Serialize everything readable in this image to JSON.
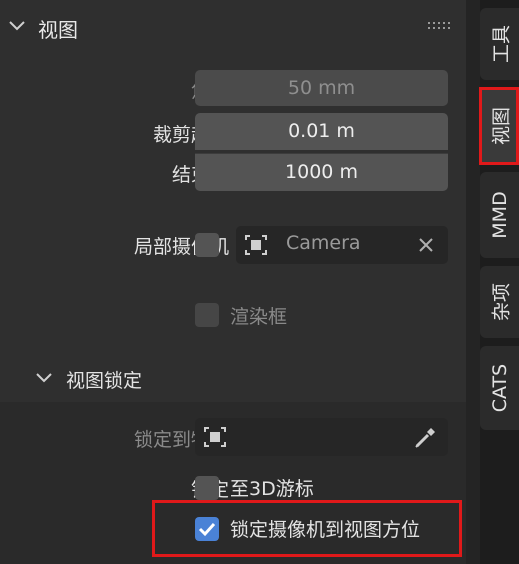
{
  "panel": {
    "title": "视图",
    "focal_length": {
      "label": "焦距",
      "value": "50 mm"
    },
    "clip_start": {
      "label": "裁剪起点",
      "value": "0.01 m"
    },
    "clip_end": {
      "label": "结束点",
      "value": "1000 m"
    },
    "local_camera": {
      "label": "局部摄像机",
      "camera_name": "Camera"
    },
    "render_region": {
      "label": "渲染框"
    }
  },
  "view_lock": {
    "title": "视图锁定",
    "lock_to_object": {
      "label": "锁定到物体"
    },
    "lock": {
      "label": "锁定",
      "option": "至3D游标"
    },
    "lock_camera_to_view": {
      "label": "锁定摄像机到视图方位",
      "checked": true
    }
  },
  "tabs": [
    {
      "label": "工具",
      "active": false
    },
    {
      "label": "视图",
      "active": true
    },
    {
      "label": "MMD",
      "active": false
    },
    {
      "label": "杂项",
      "active": false
    },
    {
      "label": "CATS",
      "active": false
    }
  ],
  "colors": {
    "highlight": "#e0191a",
    "checkbox_on": "#4a82d6"
  }
}
